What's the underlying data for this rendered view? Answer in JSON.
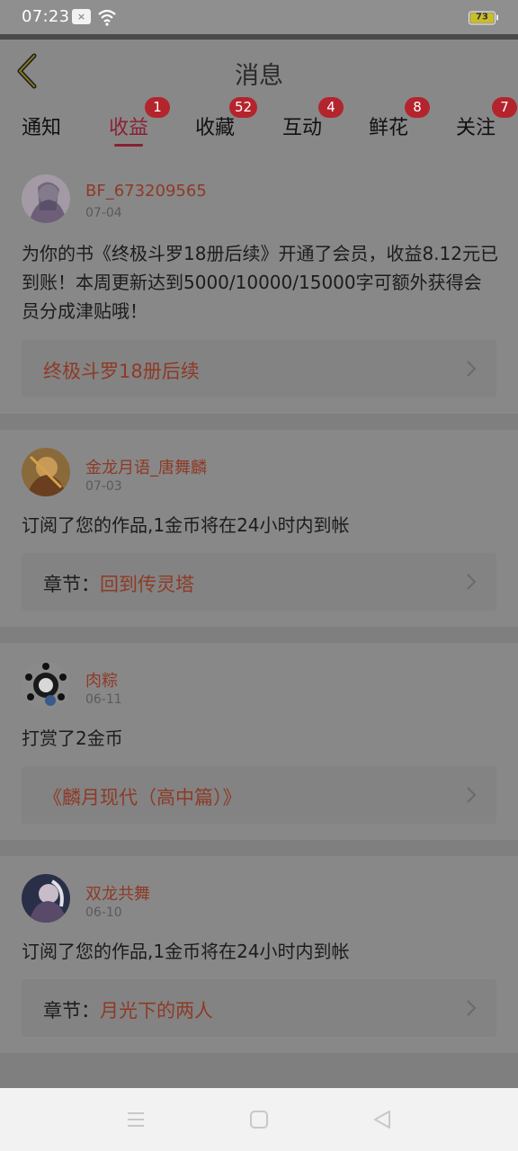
{
  "status_bar": {
    "time": "07:23",
    "notif": "×",
    "battery": "73"
  },
  "header": {
    "title": "消息"
  },
  "tabs": [
    {
      "label": "通知",
      "badge": ""
    },
    {
      "label": "收益",
      "badge": "1"
    },
    {
      "label": "收藏",
      "badge": "52"
    },
    {
      "label": "互动",
      "badge": "4"
    },
    {
      "label": "鲜花",
      "badge": "8"
    },
    {
      "label": "关注",
      "badge": "7"
    }
  ],
  "feed": [
    {
      "user": "BF_673209565",
      "date": "07-04",
      "message": "为你的书《终极斗罗18册后续》开通了会员，收益8.12元已到账！本周更新达到5000/10000/15000字可额外获得会员分成津贴哦！",
      "link_label": "",
      "link_text": "终极斗罗18册后续"
    },
    {
      "user": "金龙月语_唐舞麟",
      "date": "07-03",
      "message": "订阅了您的作品,1金币将在24小时内到帐",
      "link_label": "章节：",
      "link_text": "回到传灵塔"
    },
    {
      "user": "肉粽",
      "date": "06-11",
      "message": "打赏了2金币",
      "link_label": "",
      "link_text": "《麟月现代（高中篇）》"
    },
    {
      "user": "双龙共舞",
      "date": "06-10",
      "message": "订阅了您的作品,1金币将在24小时内到帐",
      "link_label": "章节：",
      "link_text": "月光下的两人"
    }
  ],
  "colors": {
    "accent": "#8a2132",
    "badge": "#b4242d",
    "link": "#8e3a26"
  }
}
